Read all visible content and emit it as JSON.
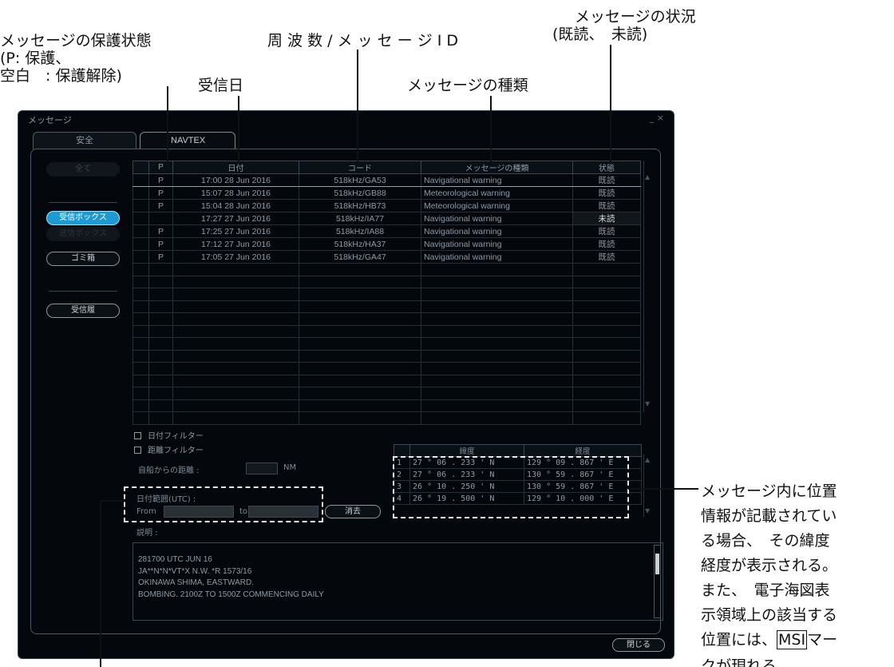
{
  "annotations": {
    "protection_line1": "メッセージの保護状態",
    "protection_line2": "(P: 保護、",
    "protection_line3": "空白　: 保護解除)",
    "received_date": "受信日",
    "freq_id": "周 波 数 / メ ッ セ ー ジ I D",
    "status_line1": "メッセージの状況",
    "status_line2": "(既読、　未読)",
    "msg_type": "メッセージの種類",
    "position_note": [
      "メッセージ内に位置",
      "情報が記載されてい",
      "る場合、　その緯度",
      "経度が表示される。",
      "また、　電子海図表",
      "示領域上の該当する"
    ],
    "position_note_last_pre": "位置には、",
    "position_note_msi": "MSI",
    "position_note_last_post": "マー",
    "position_note_cut": "クが現れる。"
  },
  "window": {
    "title": "メッセージ",
    "close": "_ ×",
    "tabs": [
      "安全",
      "NAVTEX"
    ]
  },
  "sidebar": {
    "top_button": "全て",
    "inbox": "受信ボックス",
    "outbox": "送信ボックス",
    "trash": "ゴミ箱",
    "received": "受信履"
  },
  "message_table": {
    "headers": [
      "",
      "P",
      "日付",
      "コード",
      "メッセージの種類",
      "状態"
    ],
    "rows": [
      {
        "p": "P",
        "date": "17:00 28 Jun 2016",
        "code": "518kHz/GA53",
        "type": "Navigational warning",
        "status": "既読"
      },
      {
        "p": "P",
        "date": "15:07 28 Jun 2016",
        "code": "518kHz/GB88",
        "type": "Meteorological warning",
        "status": "既読"
      },
      {
        "p": "P",
        "date": "15:04 28 Jun 2016",
        "code": "518kHz/HB73",
        "type": "Meteorological warning",
        "status": "既読"
      },
      {
        "p": "",
        "date": "17:27 27 Jun 2016",
        "code": "518kHz/IA77",
        "type": "Navigational warning",
        "status": "未読"
      },
      {
        "p": "P",
        "date": "17:25 27 Jun 2016",
        "code": "518kHz/IA88",
        "type": "Navigational warning",
        "status": "既読"
      },
      {
        "p": "P",
        "date": "17:12 27 Jun 2016",
        "code": "518kHz/HA37",
        "type": "Navigational warning",
        "status": "既読"
      },
      {
        "p": "P",
        "date": "17:05 27 Jun 2016",
        "code": "518kHz/GA47",
        "type": "Navigational warning",
        "status": "既読"
      }
    ]
  },
  "filters": {
    "date_filter": "日付フィルター",
    "distance_filter": "距離フィルター",
    "own_ship_distance": "自船からの距離 :",
    "nm_unit": "NM",
    "date_range": "日付範囲(UTC) :",
    "from": "From",
    "to": "to",
    "clear": "消去",
    "description": "説明 :"
  },
  "position_table": {
    "headers": [
      "",
      "緯度",
      "経度"
    ],
    "rows": [
      {
        "n": "1",
        "lat": "27 ° 06 . 233 ' N",
        "lon": "129 ° 09 . 867 ' E"
      },
      {
        "n": "2",
        "lat": "27 ° 06 . 233 ' N",
        "lon": "130 ° 59 . 867 ' E"
      },
      {
        "n": "3",
        "lat": "26 ° 10 . 250 ' N",
        "lon": "130 ° 59 . 867 ' E"
      },
      {
        "n": "4",
        "lat": "26 ° 19 . 500 ' N",
        "lon": "129 ° 10 . 000 ' E"
      }
    ]
  },
  "description_lines": [
    "281700 UTC JUN 16",
    "JA**N*N*VT*X N.W. *R 1573/16",
    "OKINAWA SHIMA, EASTWARD.",
    "BOMBING. 2100Z TO 1500Z COMMENCING DAILY"
  ],
  "close_button": "閉じる"
}
